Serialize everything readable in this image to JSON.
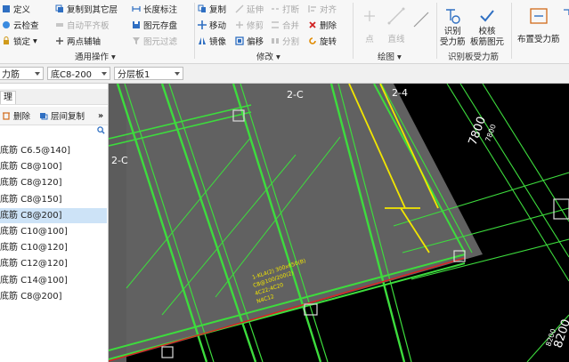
{
  "ribbon": {
    "col1": [
      "定义",
      "云检查",
      "锁定"
    ],
    "lock_arrow": "▾",
    "col2": [
      "复制到其它层",
      "自动平齐板",
      "两点辅轴"
    ],
    "col3": [
      "长度标注",
      "图元存盘",
      "图元过滤"
    ],
    "col4": [
      "复制",
      "移动",
      "镜像"
    ],
    "col5": [
      "延伸",
      "修剪",
      "偏移"
    ],
    "col6": [
      "打断",
      "合并",
      "分割"
    ],
    "col7": [
      "对齐",
      "删除",
      "旋转"
    ],
    "draw": [
      "点",
      "直线"
    ],
    "recog": [
      "识别\n受力筋",
      "校核\n板筋图元"
    ],
    "layout": "布置受力筋",
    "groups": [
      "通用操作 ▾",
      "修改 ▾",
      "绘图 ▾",
      "识别板受力筋"
    ]
  },
  "toolbar": {
    "combo1": "力筋",
    "combo2": "底C8-200",
    "combo3": "分层板1"
  },
  "panel": {
    "tab": "理",
    "delete": "删除",
    "layer_copy": "层间复制",
    "more": "»",
    "items": [
      "底筋 C6.5@140]",
      "底筋 C8@100]",
      "底筋 C8@120]",
      "底筋 C8@150]",
      "底筋 C8@200]",
      "底筋 C10@100]",
      "底筋 C10@120]",
      "底筋 C12@120]",
      "底筋 C14@100]",
      "底筋 C8@200]"
    ],
    "selected_index": 4
  },
  "canvas": {
    "axis_labels": [
      "2-C",
      "2-4",
      "2-C"
    ],
    "dims": [
      "7800",
      "7800",
      "8200",
      "8200"
    ],
    "note_lines": [
      "1-KL4(2) 300x650(B)",
      "C8@100/200(2)",
      "4C22;4C20",
      "N4C12"
    ]
  },
  "colors": {
    "canvas_bg": "#000000",
    "green": "#3ddc3d",
    "yellow": "#f2e600",
    "red": "#e02020",
    "grey_region": "#616161"
  }
}
